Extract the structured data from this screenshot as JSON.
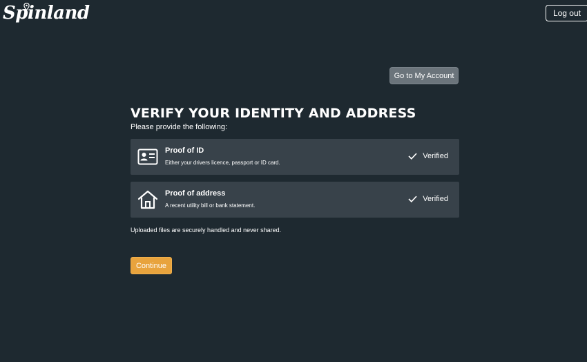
{
  "brand": {
    "name": "Spinland",
    "icon": "map-pin-icon"
  },
  "header": {
    "logout_label": "Log out"
  },
  "account_button_label": "Go to My Account",
  "main": {
    "title": "VERIFY YOUR IDENTITY AND ADDRESS",
    "subtitle": "Please provide the following:",
    "cards": [
      {
        "icon": "id-card-icon",
        "title": "Proof of ID",
        "description": "Either your drivers licence, passport or ID card.",
        "status": "Verified",
        "status_icon": "check-icon"
      },
      {
        "icon": "house-icon",
        "title": "Proof of address",
        "description": "A recent utility bill or bank statement.",
        "status": "Verified",
        "status_icon": "check-icon"
      }
    ],
    "note": "Uploaded files are securely handled and never shared.",
    "continue_label": "Continue"
  },
  "colors": {
    "background": "#1e2930",
    "card": "#38424a",
    "accent": "#e8a33d",
    "secondary_button": "#6b747b"
  }
}
